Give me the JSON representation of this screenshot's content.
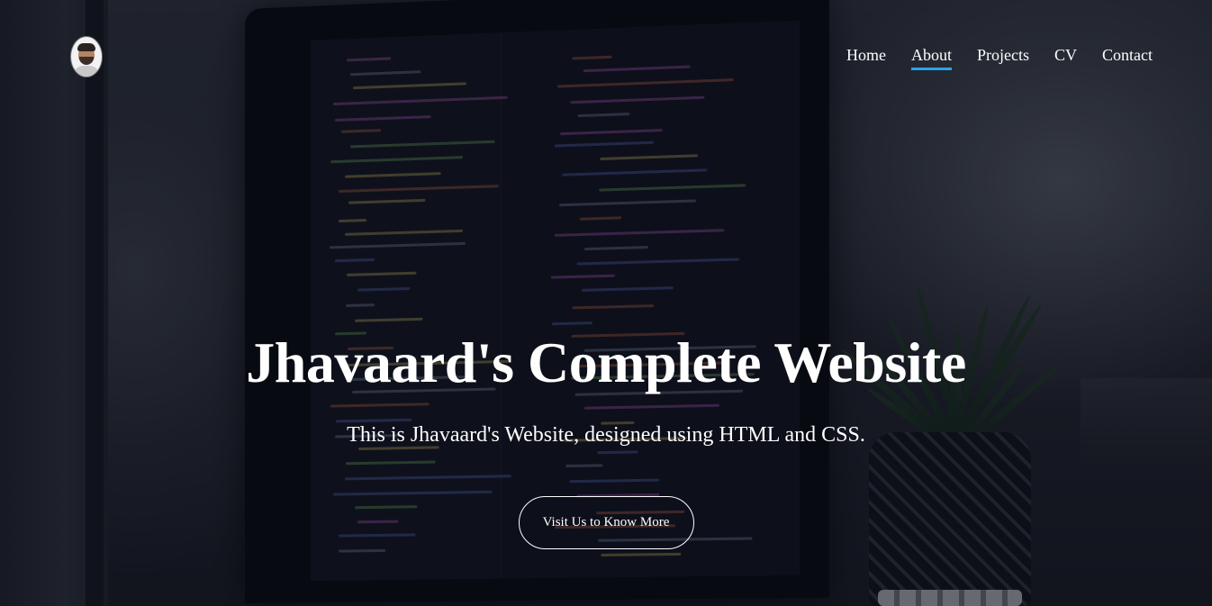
{
  "nav": {
    "logo_alt": "Jhavaard profile photo",
    "items": [
      {
        "label": "Home",
        "active": false
      },
      {
        "label": "About",
        "active": true
      },
      {
        "label": "Projects",
        "active": false
      },
      {
        "label": "CV",
        "active": false
      },
      {
        "label": "Contact",
        "active": false
      }
    ],
    "active_color": "#2aa3e8"
  },
  "hero": {
    "title": "Jhavaard's Complete Website",
    "subtitle": "This is Jhavaard's Website, designed using HTML and CSS.",
    "cta_label": "Visit Us to Know More"
  },
  "background": {
    "description_icon": "laptop-with-code-and-plant-photo"
  }
}
